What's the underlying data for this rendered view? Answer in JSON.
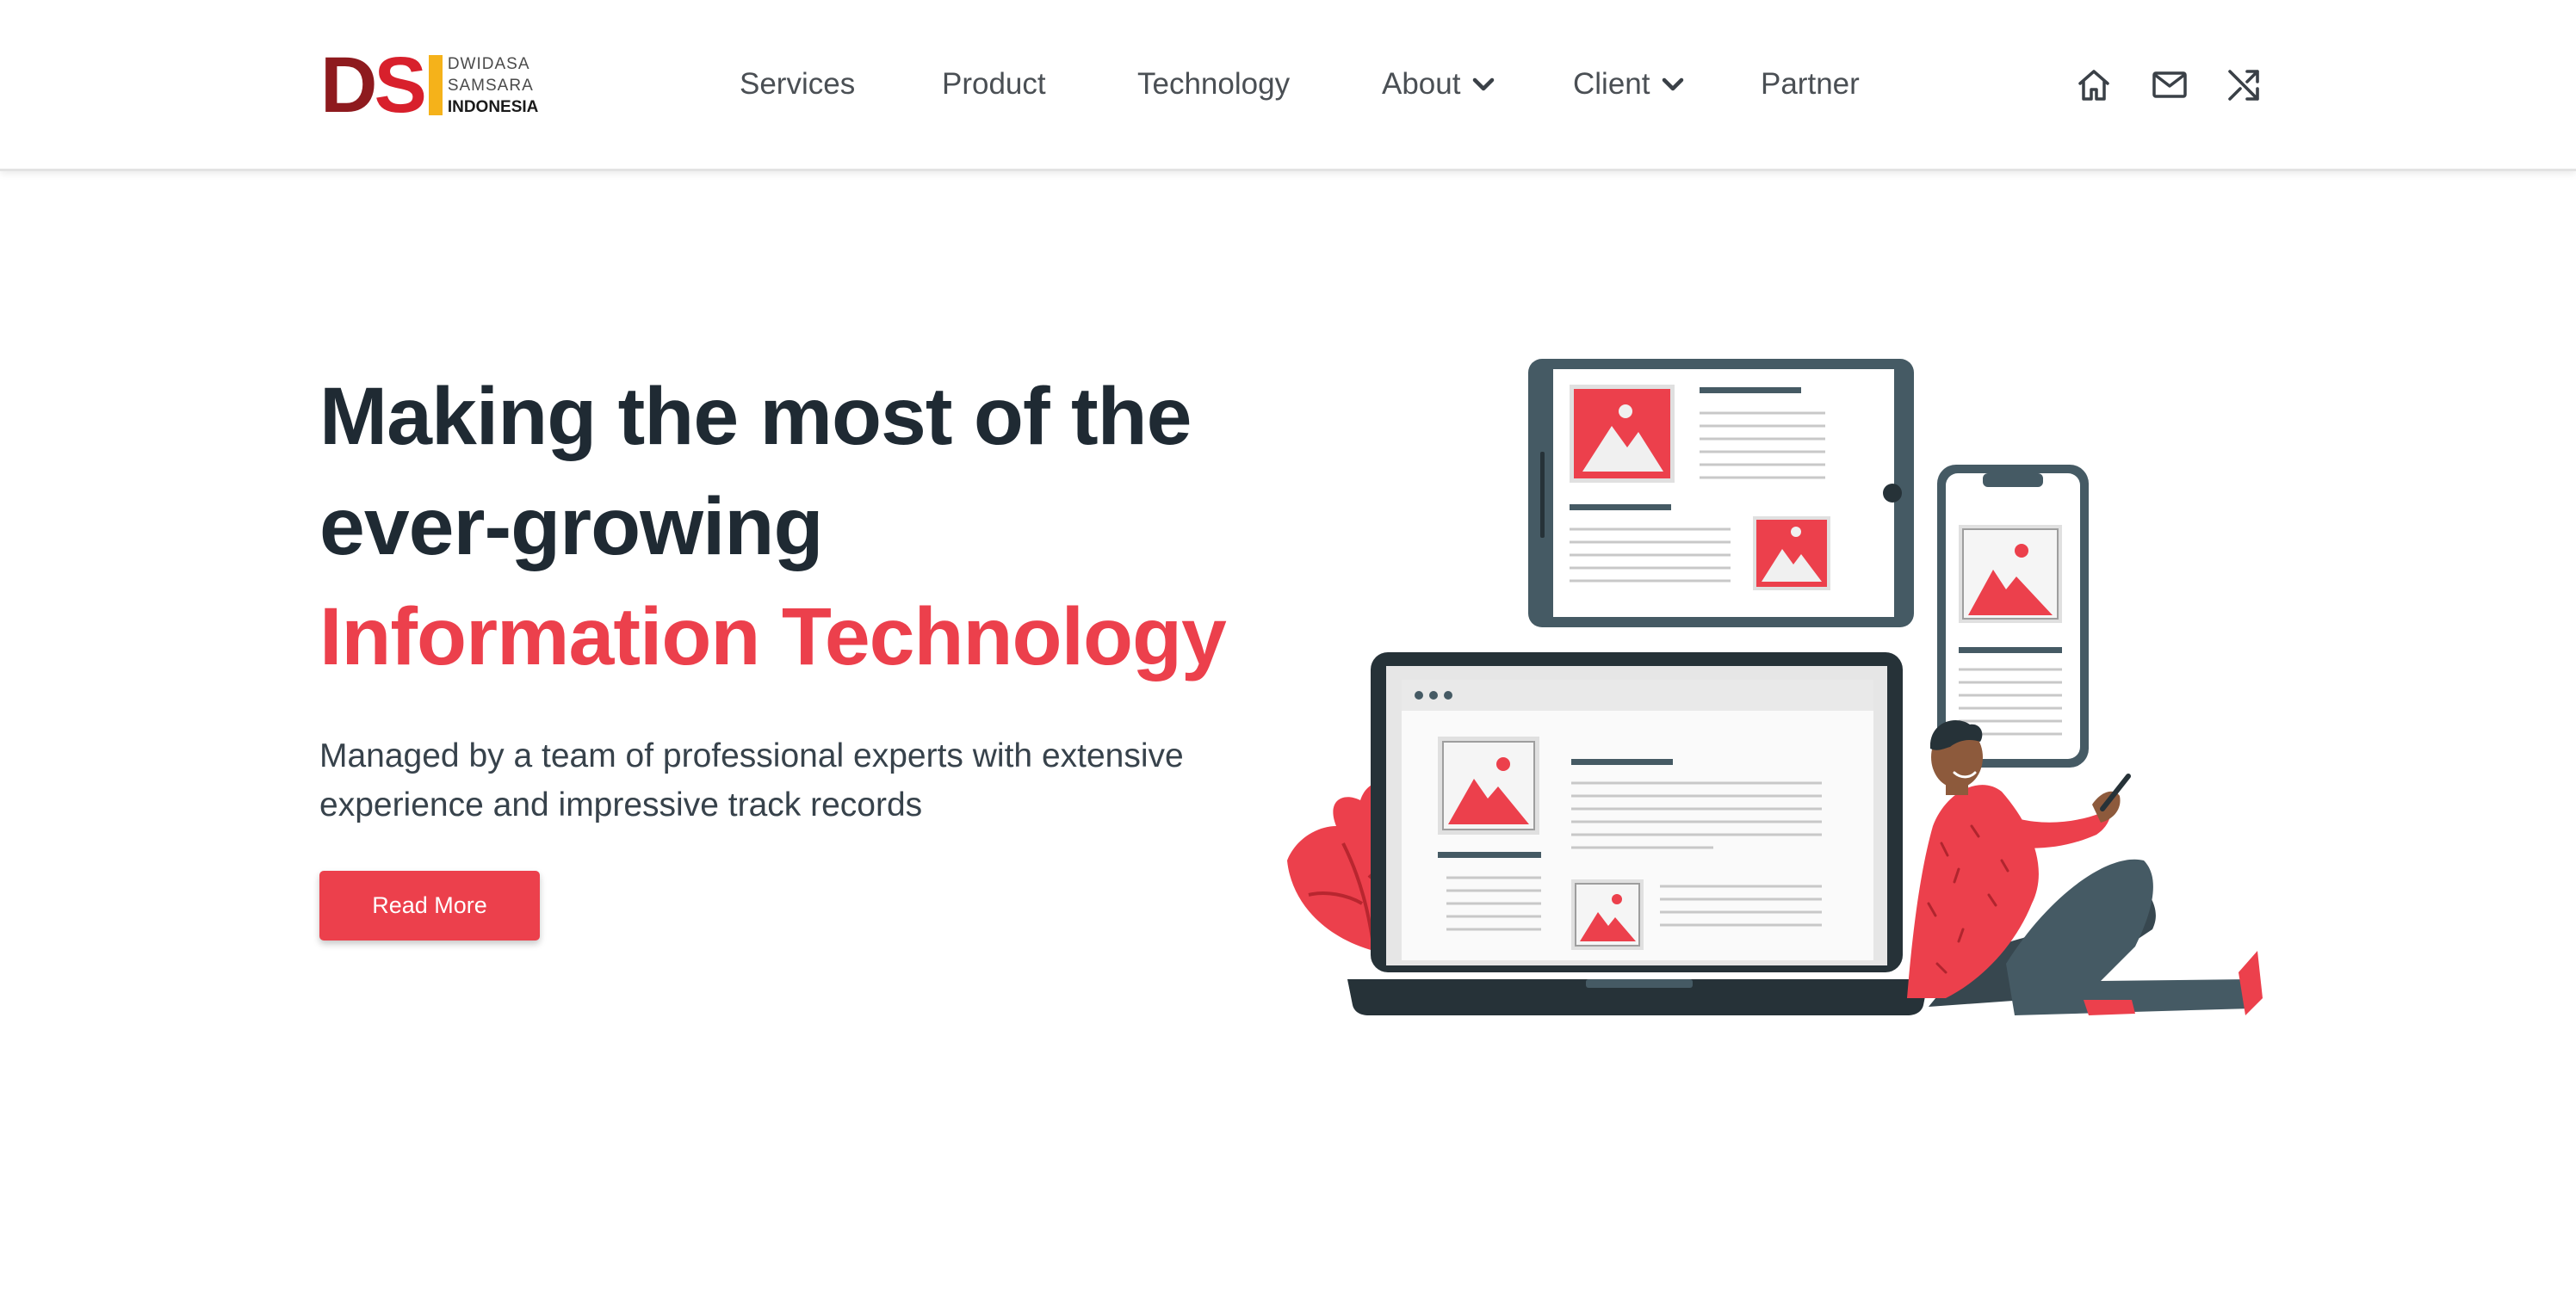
{
  "header": {
    "logo": {
      "mark_d": "D",
      "mark_s": "S",
      "line1": "DWIDASA",
      "line2": "SAMSARA",
      "line3": "INDONESIA"
    },
    "nav": [
      {
        "label": "Services",
        "has_dropdown": false
      },
      {
        "label": "Product",
        "has_dropdown": false
      },
      {
        "label": "Technology",
        "has_dropdown": false
      },
      {
        "label": "About",
        "has_dropdown": true
      },
      {
        "label": "Client",
        "has_dropdown": true
      },
      {
        "label": "Partner",
        "has_dropdown": false
      }
    ],
    "icons": [
      "home-icon",
      "mail-icon",
      "shuffle-icon"
    ]
  },
  "hero": {
    "title_line1": "Making the most of the",
    "title_line2": "ever-growing",
    "title_accent": "Information Technology",
    "subtitle": "Managed by a team of professional experts with extensive experience and impressive track records",
    "button_label": "Read More"
  },
  "colors": {
    "accent": "#ec404c",
    "dark_text": "#1f2a33",
    "nav_text": "#4a4f54",
    "device_frame": "#455a64",
    "logo_dark_red": "#8e1a1e",
    "logo_red": "#d8202c",
    "logo_yellow": "#f5b21a"
  }
}
